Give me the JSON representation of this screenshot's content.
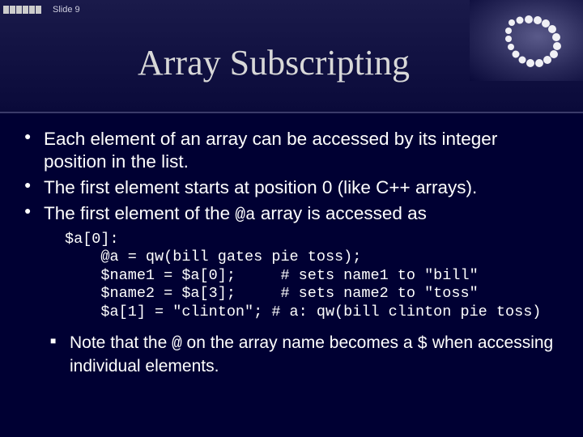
{
  "header": {
    "slide_label": "Slide 9",
    "title": "Array Subscripting"
  },
  "bullets": [
    "Each element of an array can be accessed by its integer position in the list.",
    "The first element starts at position 0 (like C++ arrays).",
    {
      "pre": "The first element of the ",
      "code": "@a",
      "post": " array is accessed as"
    }
  ],
  "code": "$a[0]:\n    @a = qw(bill gates pie toss);\n    $name1 = $a[0];     # sets name1 to \"bill\"\n    $name2 = $a[3];     # sets name2 to \"toss\"\n    $a[1] = \"clinton\"; # a: qw(bill clinton pie toss)",
  "note": {
    "pre": "Note that the ",
    "code1": "@",
    "mid": " on the array name becomes a ",
    "code2": "$",
    "post": " when accessing individual elements."
  }
}
